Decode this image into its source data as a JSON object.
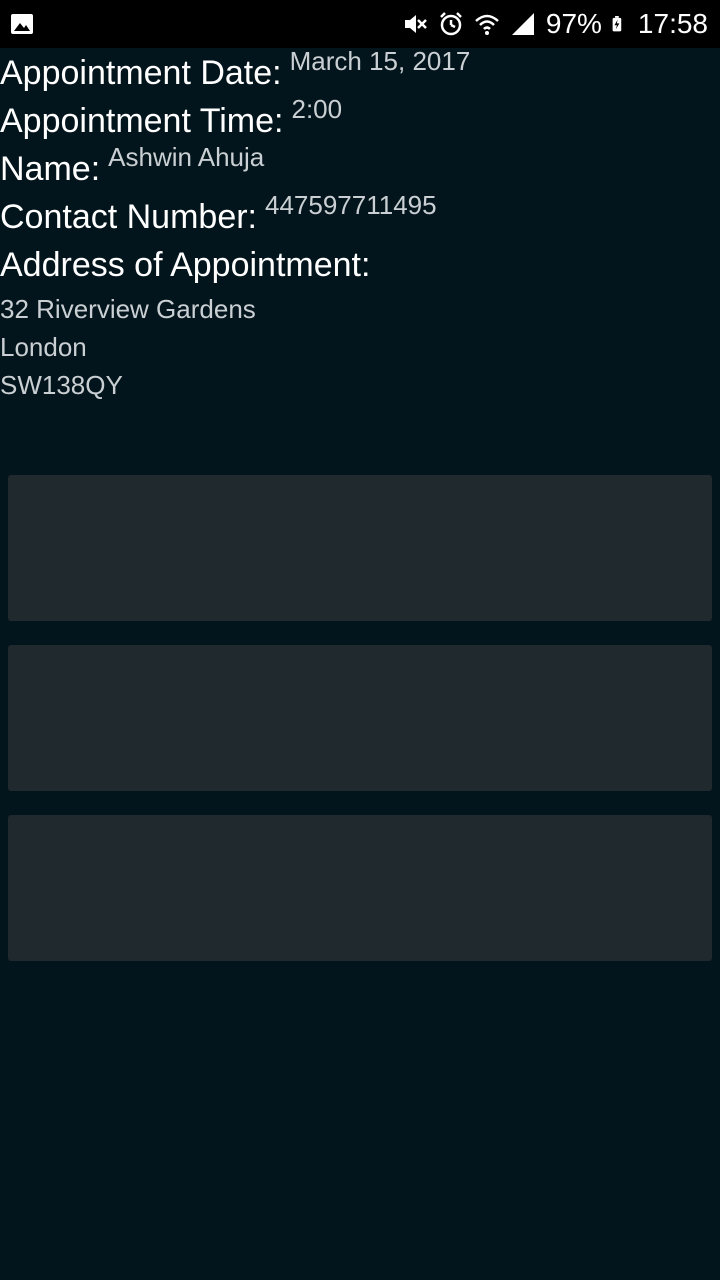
{
  "status_bar": {
    "battery_percent": "97%",
    "time": "17:58",
    "icons": [
      "image-icon",
      "mute-icon",
      "alarm-icon",
      "wifi-icon",
      "signal-icon",
      "battery-charging-icon"
    ]
  },
  "appointment": {
    "date_label": "Appointment Date:",
    "date_value": "March 15, 2017",
    "time_label": "Appointment Time:",
    "time_value": "2:00",
    "name_label": "Name:",
    "name_value": "Ashwin Ahuja",
    "contact_label": "Contact Number:",
    "contact_value": "447597711495",
    "address_label": "Address of Appointment:",
    "address_lines": [
      "32 Riverview Gardens",
      "London",
      "SW138QY"
    ]
  },
  "actions": {
    "buttons": [
      "",
      "",
      ""
    ]
  },
  "colors": {
    "background": "#03151c",
    "status_bar": "#000000",
    "button": "#1f292e",
    "label_text": "#ffffff",
    "value_text": "#c9cfd2"
  }
}
